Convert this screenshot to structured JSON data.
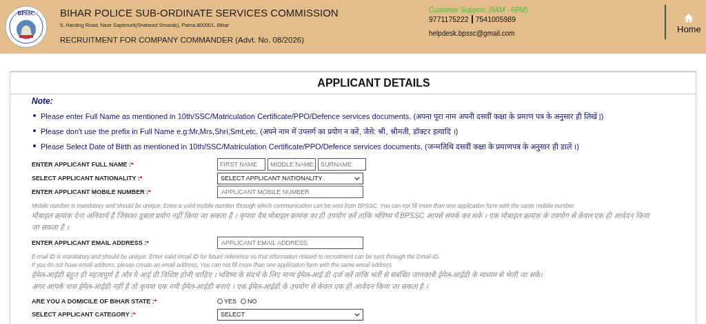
{
  "header": {
    "logo_text": "BPSSC",
    "title": "BIHAR POLICE SUB-ORDINATE SERVICES COMMISSION",
    "address": "5, Harding Road, Near Saptmurti(Shaheed Smarak), Patna-800001, Bihar",
    "recruitment": "RECRUITMENT FOR COMPANY COMMANDER (Advt. No. 08/2026)",
    "support": {
      "label": "Customer Support: (9AM - 6PM)",
      "phones": [
        "9771175222",
        "7541005989"
      ],
      "email": "helpdesk.bpssc@gmail.com"
    },
    "home_link": "Home"
  },
  "form": {
    "title": "APPLICANT DETAILS",
    "note_heading": "Note:",
    "notes": [
      "Please enter Full Name as mentioned in 10th/SSC/Matriculation Certificate/PPO/Defence services documents. (अपना पूरा नाम अपनी दसवीं कक्षा के प्रमाण पत्र के अनुसार ही लिखें |)",
      "Please don't use the prefix in Full Name e.g:Mr,Mrs,Shri,Smt,etc. (अपने नाम में उपसर्ग का प्रयोग न करें, जैसे: श्री, श्रीमती, डॉक्टर इत्यादि ।)",
      "Please Select Date of Birth as mentioned in 10th/SSC/Matriculation Certificate/PPO/Defence services documents. (जन्मतिथि दसवीं कक्षा के प्रमाणपत्र के अनुसार ही डालें ।)"
    ],
    "fields": [
      {
        "kind": "names",
        "label": "ENTER APPLICANT FULL NAME :",
        "mark": "*",
        "placeholders": [
          "FIRST NAME",
          "MIDDLE NAME",
          "SURNAME"
        ]
      },
      {
        "kind": "select",
        "label": "SELECT APPLICANT NATIONALITY :",
        "mark": "*",
        "value": "SELECT APPLICANT NATIONALITY"
      },
      {
        "kind": "text",
        "label": "ENTER APPLICANT MOBILE NUMBER :",
        "mark": "*",
        "placeholder": "APPLICANT MOBILE NUMBER"
      },
      {
        "kind": "help",
        "lines": [
          {
            "kind": "latin",
            "text": "Mobile number is mandatory and should be unique. Enter a valid mobile number through which communication can be sent from BPSSC. You can not fill more than one application form with the same mobile number."
          },
          {
            "kind": "devanagari",
            "text": "मोबाइल क्रमांक देना अनिवार्य है जिसका दुबारा प्रयोग नहीं किया जा सकता है । कृपया वैध मोबाइल क्रमांक का ही उपयोग करें ताकि भविष्य में BPSSC आपसे संपर्क कर सके । एक मोबाइल क्रमांक के उपयोग से केवल एक ही आवेदन किया जा सकता है ।"
          }
        ]
      },
      {
        "kind": "text",
        "label": "ENTER APPLICANT EMAIL ADDRESS :",
        "mark": "*",
        "placeholder": "APPLICANT EMAIL ADDRESS"
      },
      {
        "kind": "help",
        "lines": [
          {
            "kind": "latin",
            "text": "E-mail ID is mandatory and should be unique. Enter valid email ID for future reference so that information related to recruitment can be sent through the Email-ID."
          },
          {
            "kind": "latin",
            "text": "If you do not have email address, please create an email address, You can not fill more than one application form with the same email address"
          },
          {
            "kind": "devanagari",
            "text": "ईमेल-आईडी बहुत ही महत्वपूर्ण है और ये आई डी विशिष्ट होनी चाहिए । भविष्य के संदर्भ के लिए मान्य ईमेल-आई डी दर्ज करें ताकि भर्ती से संबंधित जानकारी ईमेल-आईडी के माध्यम से भेजी जा सके।"
          },
          {
            "kind": "devanagari",
            "text": "अगर आपके पास ईमेल-आईडी नहीं है तो कृपया एक नयी ईमेल-आईडी बनाएं । एक ईमेल-आईडी के उपयोग से केवल एक ही आवेदन किया जा सकता है ।"
          }
        ]
      },
      {
        "kind": "radio",
        "label": "ARE YOU A DOMICILE OF BIHAR STATE :",
        "mark": "*",
        "options": [
          {
            "label": "YES",
            "selected": false
          },
          {
            "label": "NO",
            "selected": false
          }
        ]
      },
      {
        "kind": "select",
        "label": "SELECT APPLICANT CATEGORY :",
        "mark": "*",
        "value": "SELECT"
      }
    ]
  }
}
